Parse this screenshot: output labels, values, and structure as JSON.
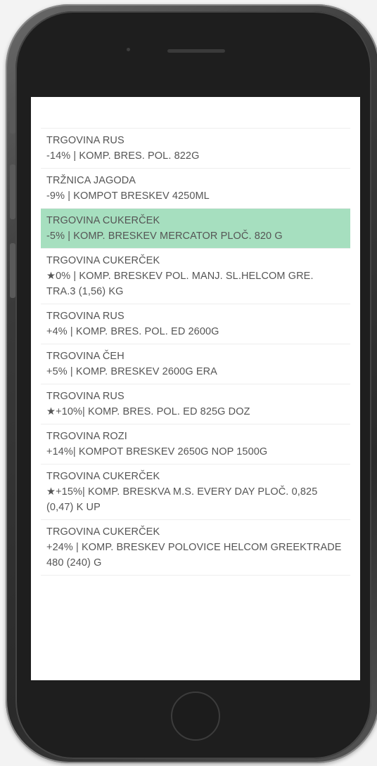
{
  "items": [
    {
      "store": "TRGOVINA RUS",
      "detail": "-14% | KOMP. BRES. POL. 822G",
      "highlighted": false
    },
    {
      "store": "TRŽNICA JAGODA",
      "detail": "-9% | KOMPOT BRESKEV 4250ML",
      "highlighted": false
    },
    {
      "store": "TRGOVINA CUKERČEK",
      "detail": "-5% | KOMP. BRESKEV MERCATOR PLOČ. 820 G",
      "highlighted": true
    },
    {
      "store": "TRGOVINA CUKERČEK",
      "detail": "★0% | KOMP. BRESKEV POL. MANJ. SL.HELCOM GRE. TRA.3 (1,56) KG",
      "highlighted": false
    },
    {
      "store": "TRGOVINA RUS",
      "detail": "+4% | KOMP. BRES. POL. ED 2600G",
      "highlighted": false
    },
    {
      "store": "TRGOVINA ČEH",
      "detail": "+5% | KOMP. BRESKEV 2600G ERA",
      "highlighted": false
    },
    {
      "store": "TRGOVINA RUS",
      "detail": "★+10%| KOMP. BRES. POL. ED 825G DOZ",
      "highlighted": false
    },
    {
      "store": "TRGOVINA ROZI",
      "detail": "+14%| KOMPOT BRESKEV 2650G NOP 1500G",
      "highlighted": false
    },
    {
      "store": "TRGOVINA CUKERČEK",
      "detail": "★+15%| KOMP. BRESKVA M.S. EVERY DAY PLOČ. 0,825 (0,47) K UP",
      "highlighted": false
    },
    {
      "store": "TRGOVINA CUKERČEK",
      "detail": "+24% | KOMP. BRESKEV POLOVICE HELCOM GREEKTRADE 480 (240) G",
      "highlighted": false
    }
  ],
  "colors": {
    "highlight": "#a6dfbf",
    "text": "#555555"
  }
}
